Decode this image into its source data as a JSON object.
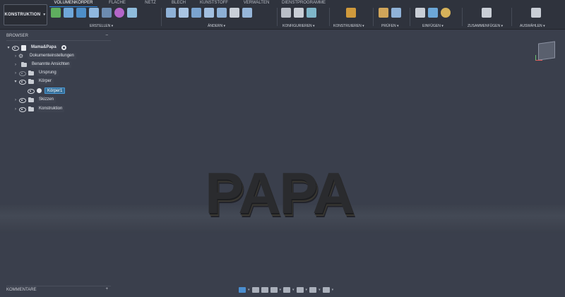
{
  "toolbar": {
    "workspace": "KONSTRUKTION",
    "tabs": [
      "VOLUMENKÖRPER",
      "FLÄCHE",
      "NETZ",
      "BLECH",
      "KUNSTSTOFF",
      "VERWALTEN",
      "DIENSTPROGRAMME"
    ],
    "active_tab": "VOLUMENKÖRPER",
    "groups": [
      "ERSTELLEN",
      "ÄNDERN",
      "KONFIGURIEREN",
      "KONSTRUIEREN",
      "PRÜFEN",
      "EINFÜGEN",
      "ZUSAMMENFÜGEN",
      "AUSWÄHLEN"
    ],
    "accent_color": "#2e8be6"
  },
  "browser": {
    "title": "BROWSER",
    "items": [
      {
        "label": "Mama&Papa",
        "icon": "document-icon"
      },
      {
        "label": "Dokumenteinstellungen",
        "icon": "gear-icon"
      },
      {
        "label": "Benannte Ansichten",
        "icon": "folder-icon"
      },
      {
        "label": "Ursprung",
        "icon": "folder-icon"
      },
      {
        "label": "Körper",
        "icon": "folder-icon"
      },
      {
        "label": "Körper1",
        "icon": "body-icon"
      },
      {
        "label": "Skizzen",
        "icon": "folder-icon"
      },
      {
        "label": "Konstruktion",
        "icon": "folder-icon"
      }
    ]
  },
  "viewport": {
    "model_text": "PAPA"
  },
  "comments": {
    "title": "KOMMENTARE"
  }
}
